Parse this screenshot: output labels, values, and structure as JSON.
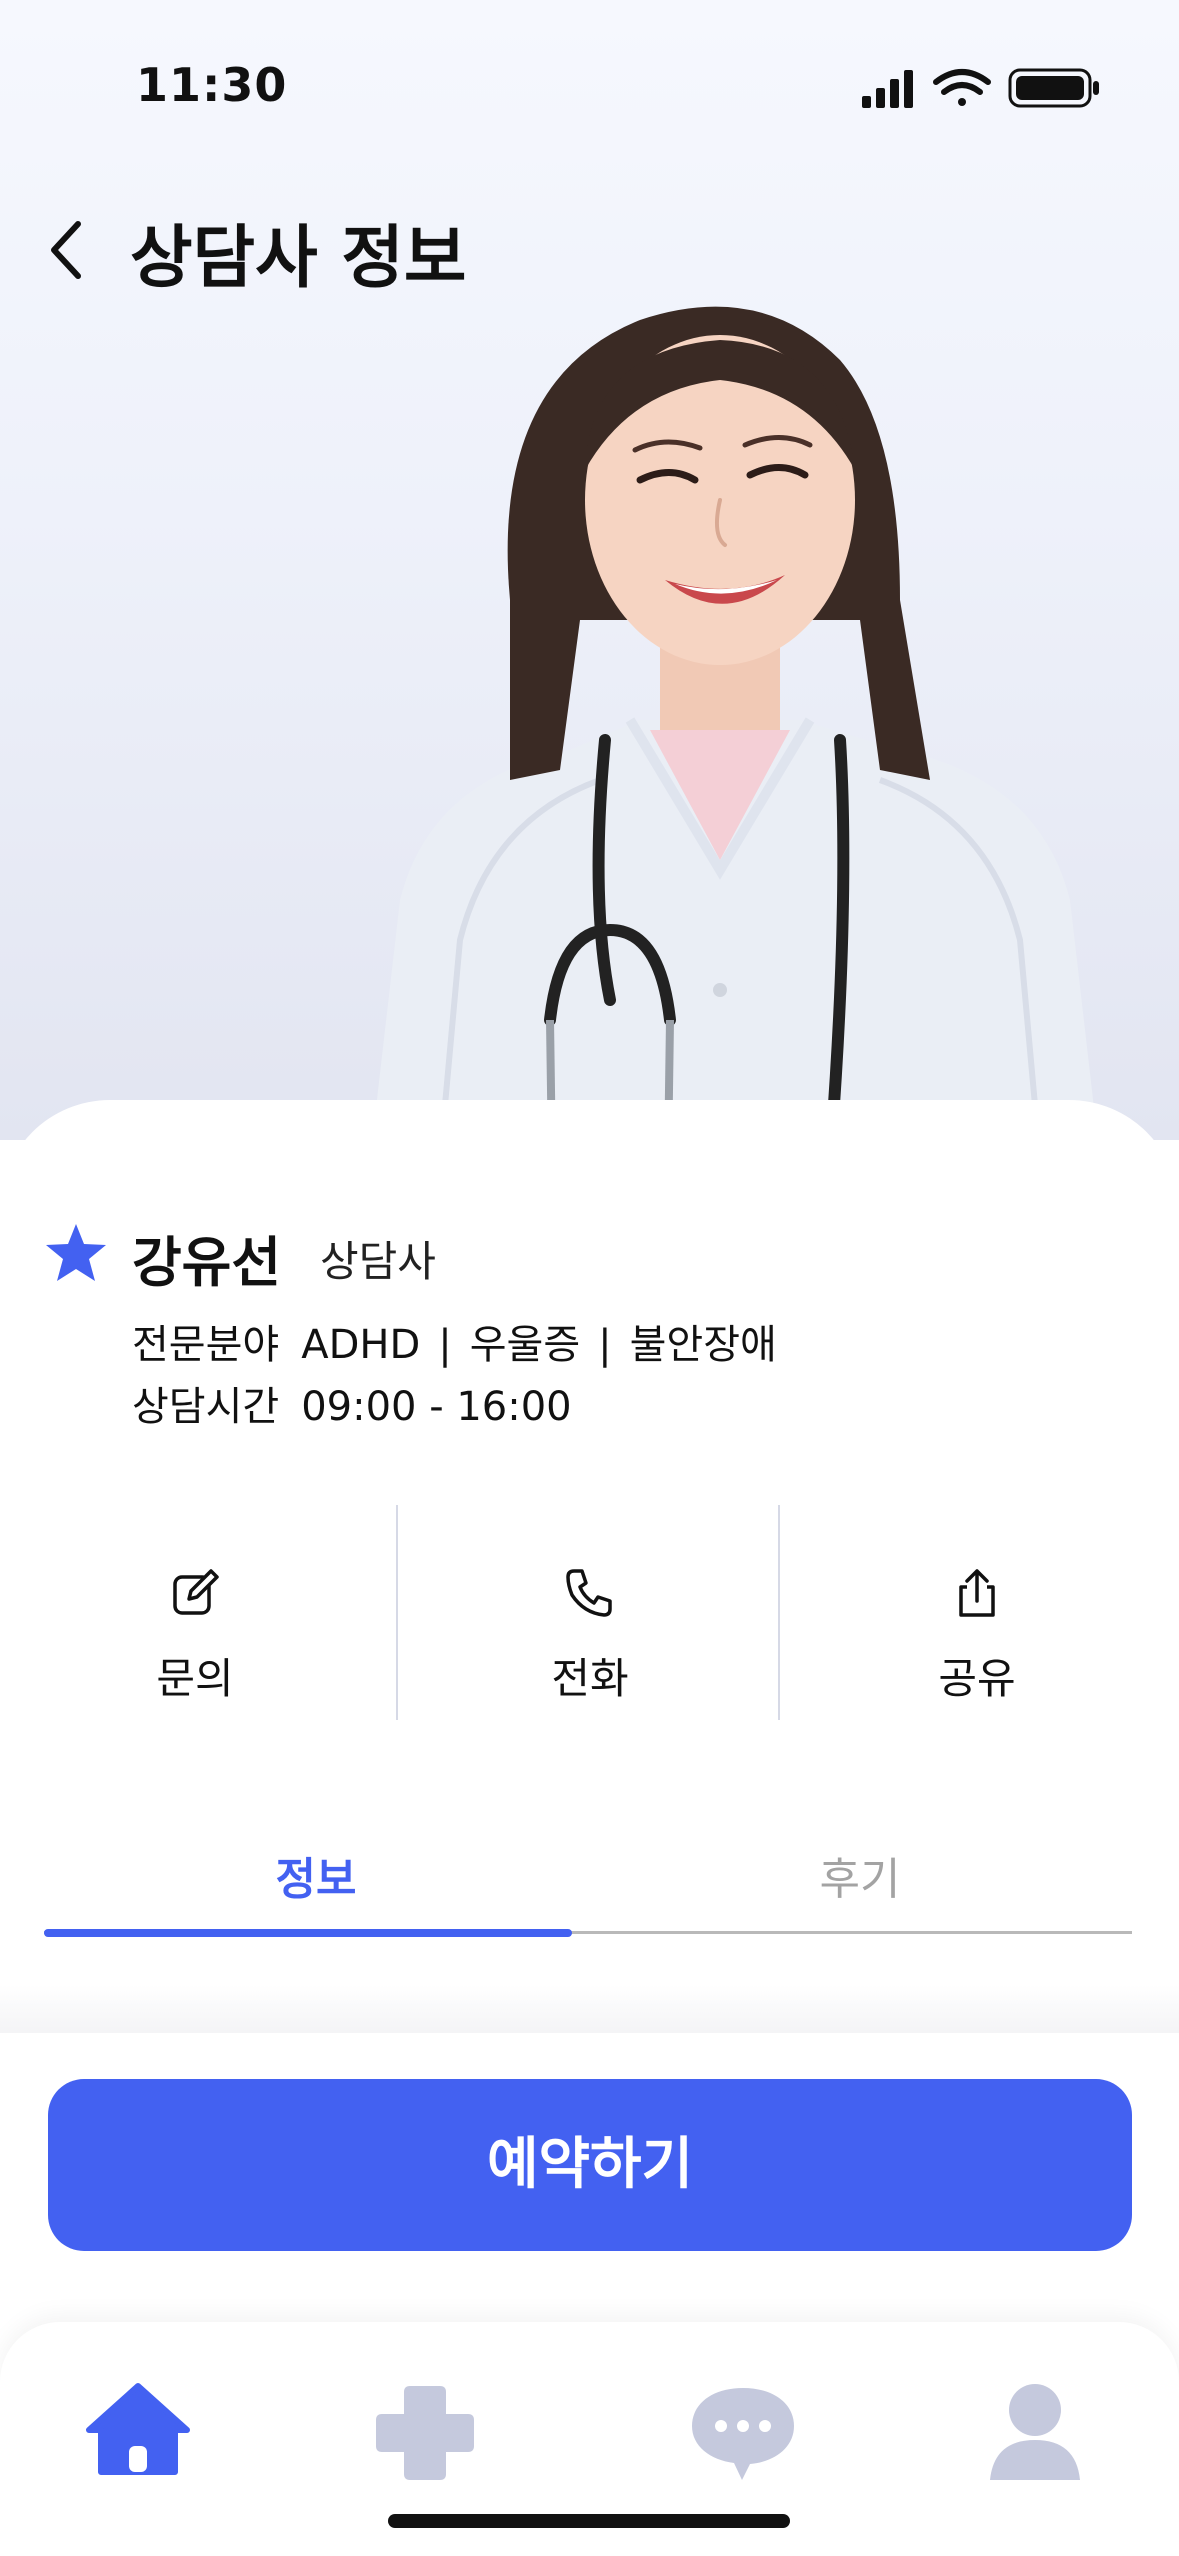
{
  "status_bar": {
    "time": "11:30"
  },
  "header": {
    "title": "상담사 정보"
  },
  "counselor": {
    "name": "강유선",
    "role": "상담사",
    "specialty_label": "전문분야",
    "specialties": [
      "ADHD",
      "우울증",
      "불안장애"
    ],
    "separator": "|",
    "hours_label": "상담시간",
    "hours": "09:00 - 16:00",
    "photo_icon": "counselor-photo"
  },
  "actions": [
    {
      "label": "문의",
      "icon": "edit-icon"
    },
    {
      "label": "전화",
      "icon": "phone-icon"
    },
    {
      "label": "공유",
      "icon": "share-icon"
    }
  ],
  "tabs": [
    {
      "label": "정보",
      "active": true
    },
    {
      "label": "후기",
      "active": false
    }
  ],
  "cta": {
    "label": "예약하기"
  },
  "bottom_nav": [
    {
      "icon": "home-icon",
      "active": true
    },
    {
      "icon": "medical-cross-icon",
      "active": false
    },
    {
      "icon": "chat-icon",
      "active": false
    },
    {
      "icon": "profile-icon",
      "active": false
    }
  ],
  "colors": {
    "accent": "#4361f1",
    "inactive_icon": "#c5c9dd",
    "inactive_text": "#a3a3a3"
  }
}
